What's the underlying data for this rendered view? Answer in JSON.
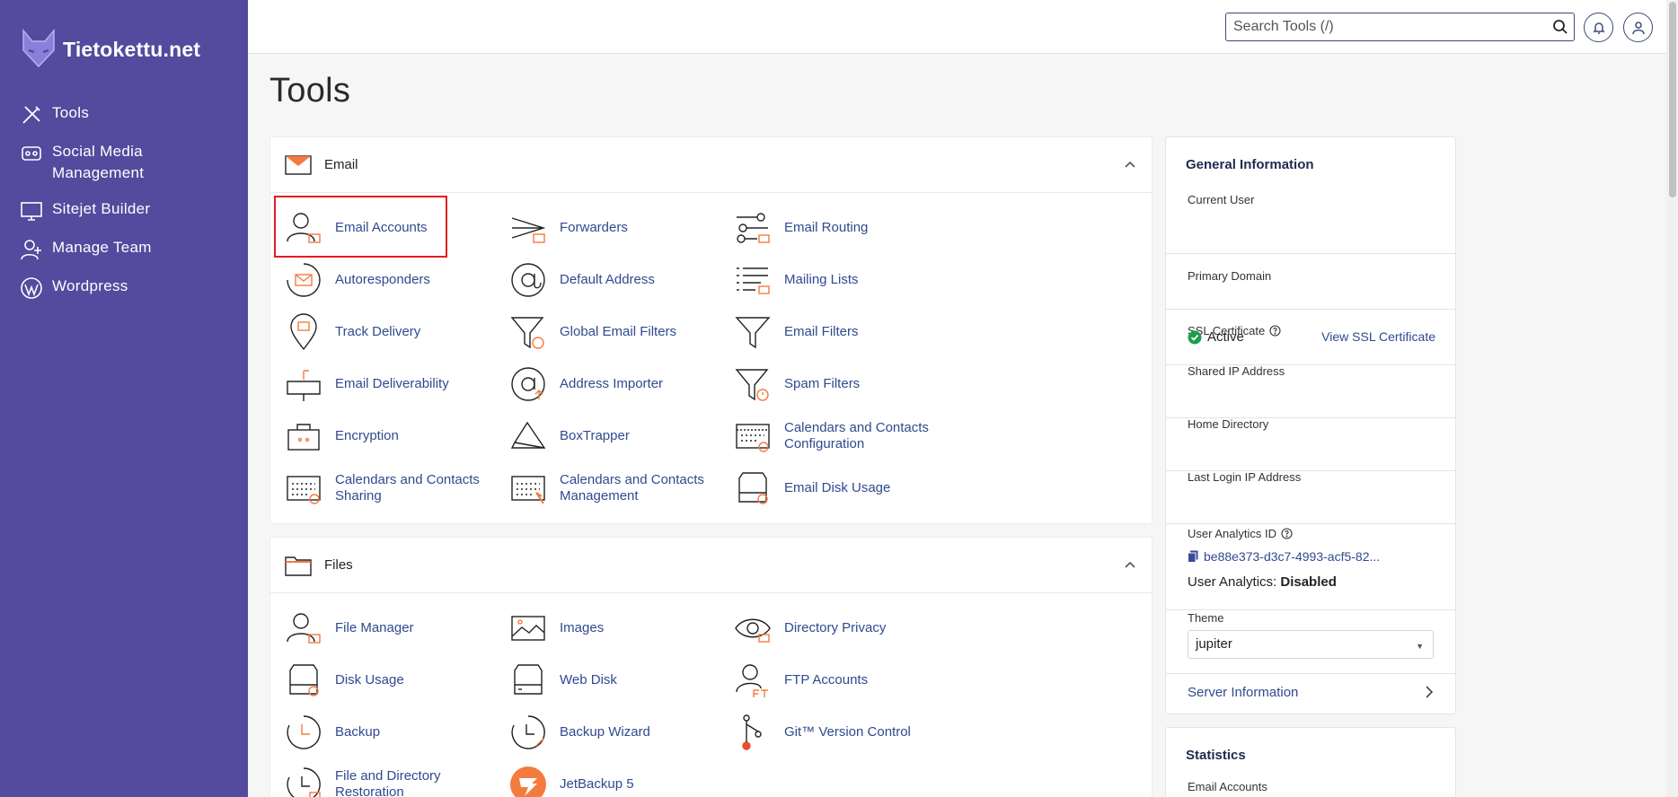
{
  "brand": {
    "name": "Tietokettu.net"
  },
  "sidebar": {
    "items": [
      {
        "label": "Tools",
        "icon": "tools-icon"
      },
      {
        "label": "Social Media Management",
        "icon": "social-media-icon"
      },
      {
        "label": "Sitejet Builder",
        "icon": "sitejet-icon"
      },
      {
        "label": "Manage Team",
        "icon": "team-icon"
      },
      {
        "label": "Wordpress",
        "icon": "wordpress-icon"
      }
    ]
  },
  "header": {
    "search_placeholder": "Search Tools (/)"
  },
  "page": {
    "title": "Tools"
  },
  "email_section": {
    "title": "Email",
    "tools": [
      "Email Accounts",
      "Forwarders",
      "Email Routing",
      "Autoresponders",
      "Default Address",
      "Mailing Lists",
      "Track Delivery",
      "Global Email Filters",
      "Email Filters",
      "Email Deliverability",
      "Address Importer",
      "Spam Filters",
      "Encryption",
      "BoxTrapper",
      "Calendars and Contacts Configuration",
      "Calendars and Contacts Sharing",
      "Calendars and Contacts Management",
      "Email Disk Usage"
    ]
  },
  "files_section": {
    "title": "Files",
    "tools": [
      "File Manager",
      "Images",
      "Directory Privacy",
      "Disk Usage",
      "Web Disk",
      "FTP Accounts",
      "Backup",
      "Backup Wizard",
      "Git™ Version Control",
      "File and Directory Restoration",
      "JetBackup 5"
    ]
  },
  "general_info": {
    "title": "General Information",
    "current_user_label": "Current User",
    "primary_domain_label": "Primary Domain",
    "ssl_label": "SSL Certificate",
    "ssl_status": "Active",
    "view_ssl": "View SSL Certificate",
    "shared_ip_label": "Shared IP Address",
    "home_dir_label": "Home Directory",
    "last_login_label": "Last Login IP Address",
    "ua_id_label": "User Analytics ID",
    "ua_id_value": "be88e373-d3c7-4993-acf5-82...",
    "ua_label": "User Analytics:",
    "ua_status": "Disabled",
    "theme_label": "Theme",
    "theme_value": "jupiter",
    "server_info": "Server Information"
  },
  "statistics": {
    "title": "Statistics",
    "email_accounts_label": "Email Accounts"
  },
  "colors": {
    "sidebar": "#544a9e",
    "link": "#2f4a8f",
    "accent": "#f47b3e",
    "highlight": "#e31b23"
  }
}
